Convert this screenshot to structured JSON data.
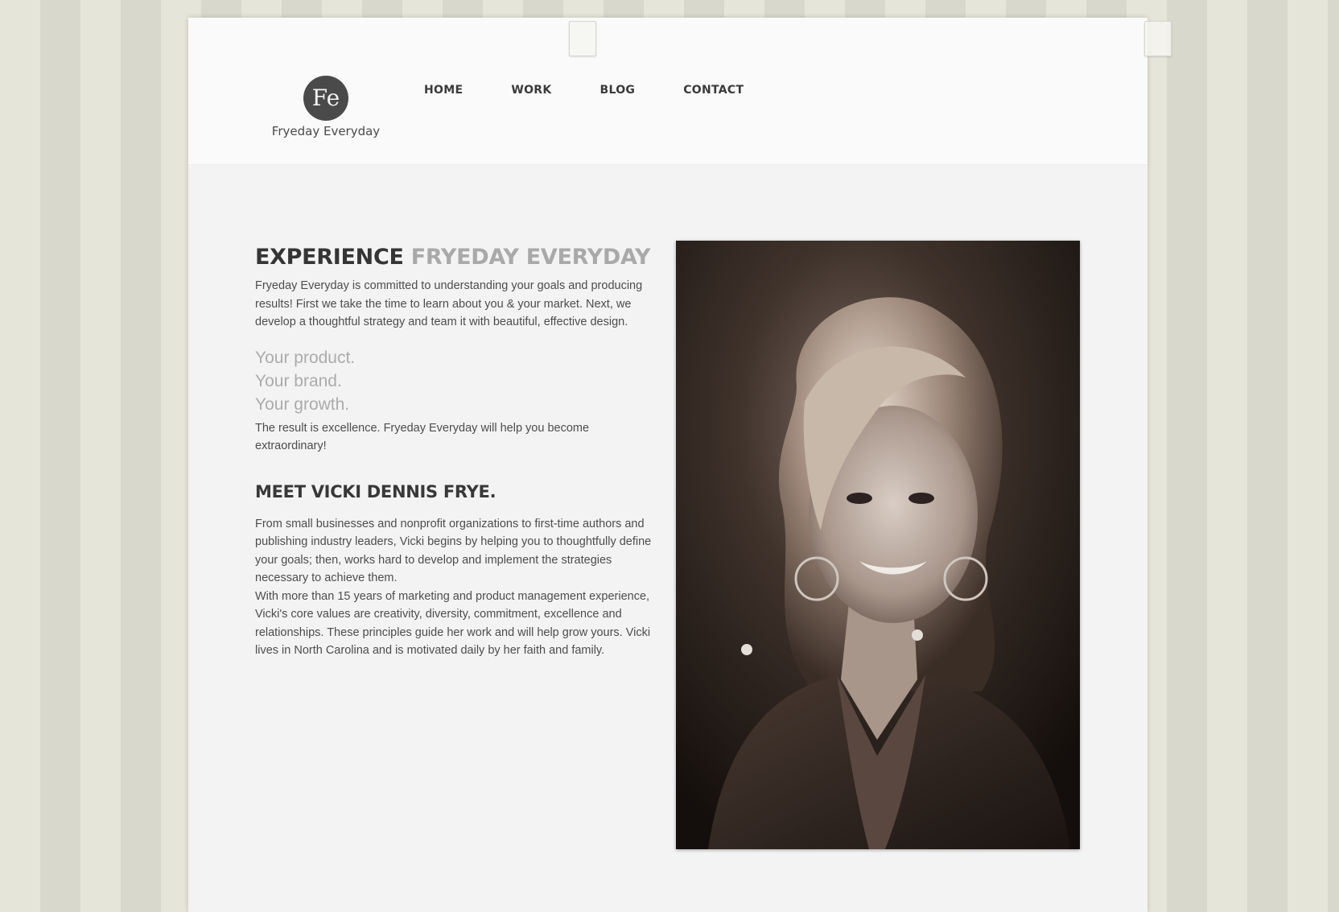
{
  "brand": {
    "name": "Fryeday Everyday",
    "monogram": "Fe"
  },
  "nav": {
    "items": [
      {
        "label": "HOME"
      },
      {
        "label": "WORK"
      },
      {
        "label": "BLOG"
      },
      {
        "label": "CONTACT"
      }
    ]
  },
  "intro": {
    "headline_dark": "EXPERIENCE",
    "headline_light": "FRYEDAY EVERYDAY",
    "paragraph": "Fryeday Everyday is committed to understanding your goals and producing results! First we take the time to learn about you & your market. Next, we develop a thoughtful strategy and team it with beautiful, effective design.",
    "taglines": [
      "Your product.",
      "Your brand.",
      "Your growth."
    ],
    "result": "The result is excellence. Fryeday Everyday will help you become extraordinary!"
  },
  "about": {
    "heading": "MEET VICKI DENNIS FRYE.",
    "paragraph_1": "From small businesses and nonprofit organizations to first-time authors and publishing industry leaders, Vicki begins by helping you to thoughtfully define your goals; then, works hard to develop and implement the strategies necessary to achieve them.",
    "paragraph_2": "With more than 15 years of marketing and product management experience, Vicki's core values are creativity, diversity, commitment, excellence and relationships. These principles guide her work and will help grow yours. Vicki lives in North Carolina and is motivated daily by her faith and family."
  },
  "colors": {
    "page_background": "#e2e1d6",
    "paper": "#f3f3f3",
    "header": "#fafafa",
    "text_dark": "#353535",
    "text_light": "#a9a9a9"
  }
}
